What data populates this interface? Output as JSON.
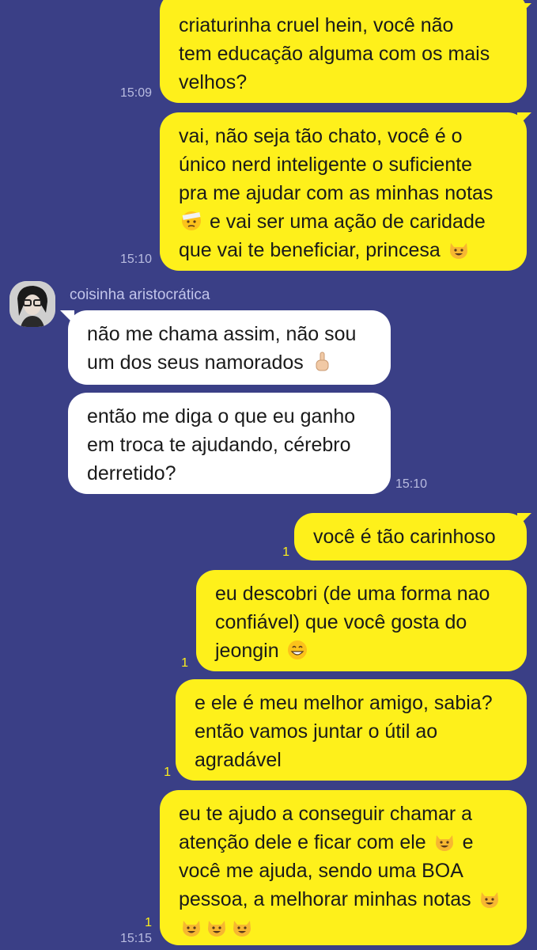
{
  "conversation": {
    "contact_name": "coisinha aristocrática",
    "messages": [
      {
        "side": "out",
        "lines": [
          "criaturinha cruel hein, você não",
          "tem educação alguma com os mais",
          "velhos?"
        ],
        "time": "15:09",
        "unread": ""
      },
      {
        "side": "out",
        "lines": [
          "vai, não seja tão chato, você é o",
          "único nerd inteligente o suficiente",
          "pra me ajudar com as minhas notas",
          "e vai ser uma ação de caridade",
          "que vai te beneficiar, princesa"
        ],
        "time": "15:10",
        "unread": ""
      },
      {
        "side": "in",
        "lines": [
          "não me chama assim, não sou",
          "um dos seus namorados"
        ],
        "time": "",
        "unread": ""
      },
      {
        "side": "in",
        "lines": [
          "então me diga o que eu ganho",
          "em troca te ajudando, cérebro",
          "derretido?"
        ],
        "time": "15:10",
        "unread": ""
      },
      {
        "side": "out",
        "lines": [
          "você é tão carinhoso"
        ],
        "time": "",
        "unread": "1"
      },
      {
        "side": "out",
        "lines": [
          "eu descobri (de uma forma nao",
          "confiável) que você gosta do",
          "jeongin"
        ],
        "time": "",
        "unread": "1"
      },
      {
        "side": "out",
        "lines": [
          "e ele é meu melhor amigo, sabia?",
          "então vamos juntar o útil ao",
          "agradável"
        ],
        "time": "",
        "unread": "1"
      },
      {
        "side": "out",
        "lines": [
          "eu te ajudo a conseguir chamar a",
          "atenção dele e ficar com ele",
          "e",
          "você me ajuda, sendo uma BOA",
          "pessoa, a melhorar minhas notas"
        ],
        "time": "15:15",
        "unread": "1"
      }
    ]
  },
  "icons": {
    "emoji_dizzy": "face-with-head-bandage-icon",
    "emoji_cat": "grinning-cat-icon",
    "emoji_finger": "middle-finger-icon",
    "emoji_grin": "grinning-face-icon"
  },
  "colors": {
    "background": "#3a3f86",
    "outgoing_bubble": "#fef01b",
    "incoming_bubble": "#ffffff",
    "unread_count": "#fef01b"
  }
}
